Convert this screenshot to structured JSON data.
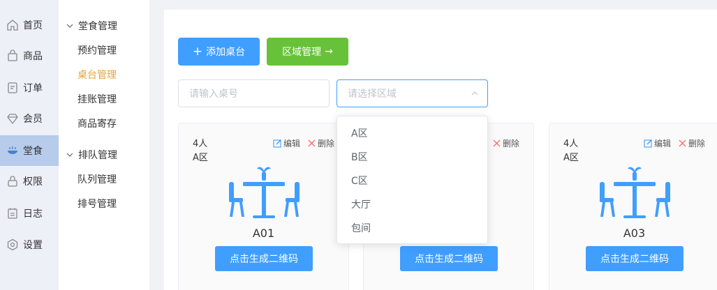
{
  "nav": {
    "items": [
      {
        "label": "首页",
        "icon": "home-icon"
      },
      {
        "label": "商品",
        "icon": "bag-icon"
      },
      {
        "label": "订单",
        "icon": "order-icon"
      },
      {
        "label": "会员",
        "icon": "diamond-icon"
      },
      {
        "label": "堂食",
        "icon": "dining-icon"
      },
      {
        "label": "权限",
        "icon": "lock-icon"
      },
      {
        "label": "日志",
        "icon": "log-icon"
      },
      {
        "label": "设置",
        "icon": "settings-icon"
      }
    ],
    "active": "堂食"
  },
  "submenu": {
    "groups": [
      {
        "title": "堂食管理",
        "items": [
          "预约管理",
          "桌台管理",
          "挂账管理",
          "商品寄存"
        ]
      },
      {
        "title": "排队管理",
        "items": [
          "队列管理",
          "排号管理"
        ]
      }
    ],
    "active": "桌台管理"
  },
  "toolbar": {
    "add_label": "添加桌台",
    "area_label": "区域管理"
  },
  "filters": {
    "table_placeholder": "请输入桌号",
    "area_placeholder": "请选择区域"
  },
  "area_dropdown": {
    "options": [
      "A区",
      "B区",
      "C区",
      "大厅",
      "包间"
    ]
  },
  "cards": [
    {
      "people": "4人",
      "area": "A区",
      "name": "A01",
      "edit": "编辑",
      "delete": "删除",
      "qr_label": "点击生成二维码"
    },
    {
      "people": "",
      "area": "",
      "name": "",
      "edit": "",
      "delete": "删除",
      "qr_label": "点击生成二维码"
    },
    {
      "people": "4人",
      "area": "A区",
      "name": "A03",
      "edit": "编辑",
      "delete": "删除",
      "qr_label": "点击生成二维码"
    }
  ],
  "colors": {
    "primary": "#409eff",
    "success": "#67c23a",
    "active_submenu": "#e6a23c",
    "active_nav_bg": "#b7cbea",
    "delete_icon": "#f56c6c"
  }
}
